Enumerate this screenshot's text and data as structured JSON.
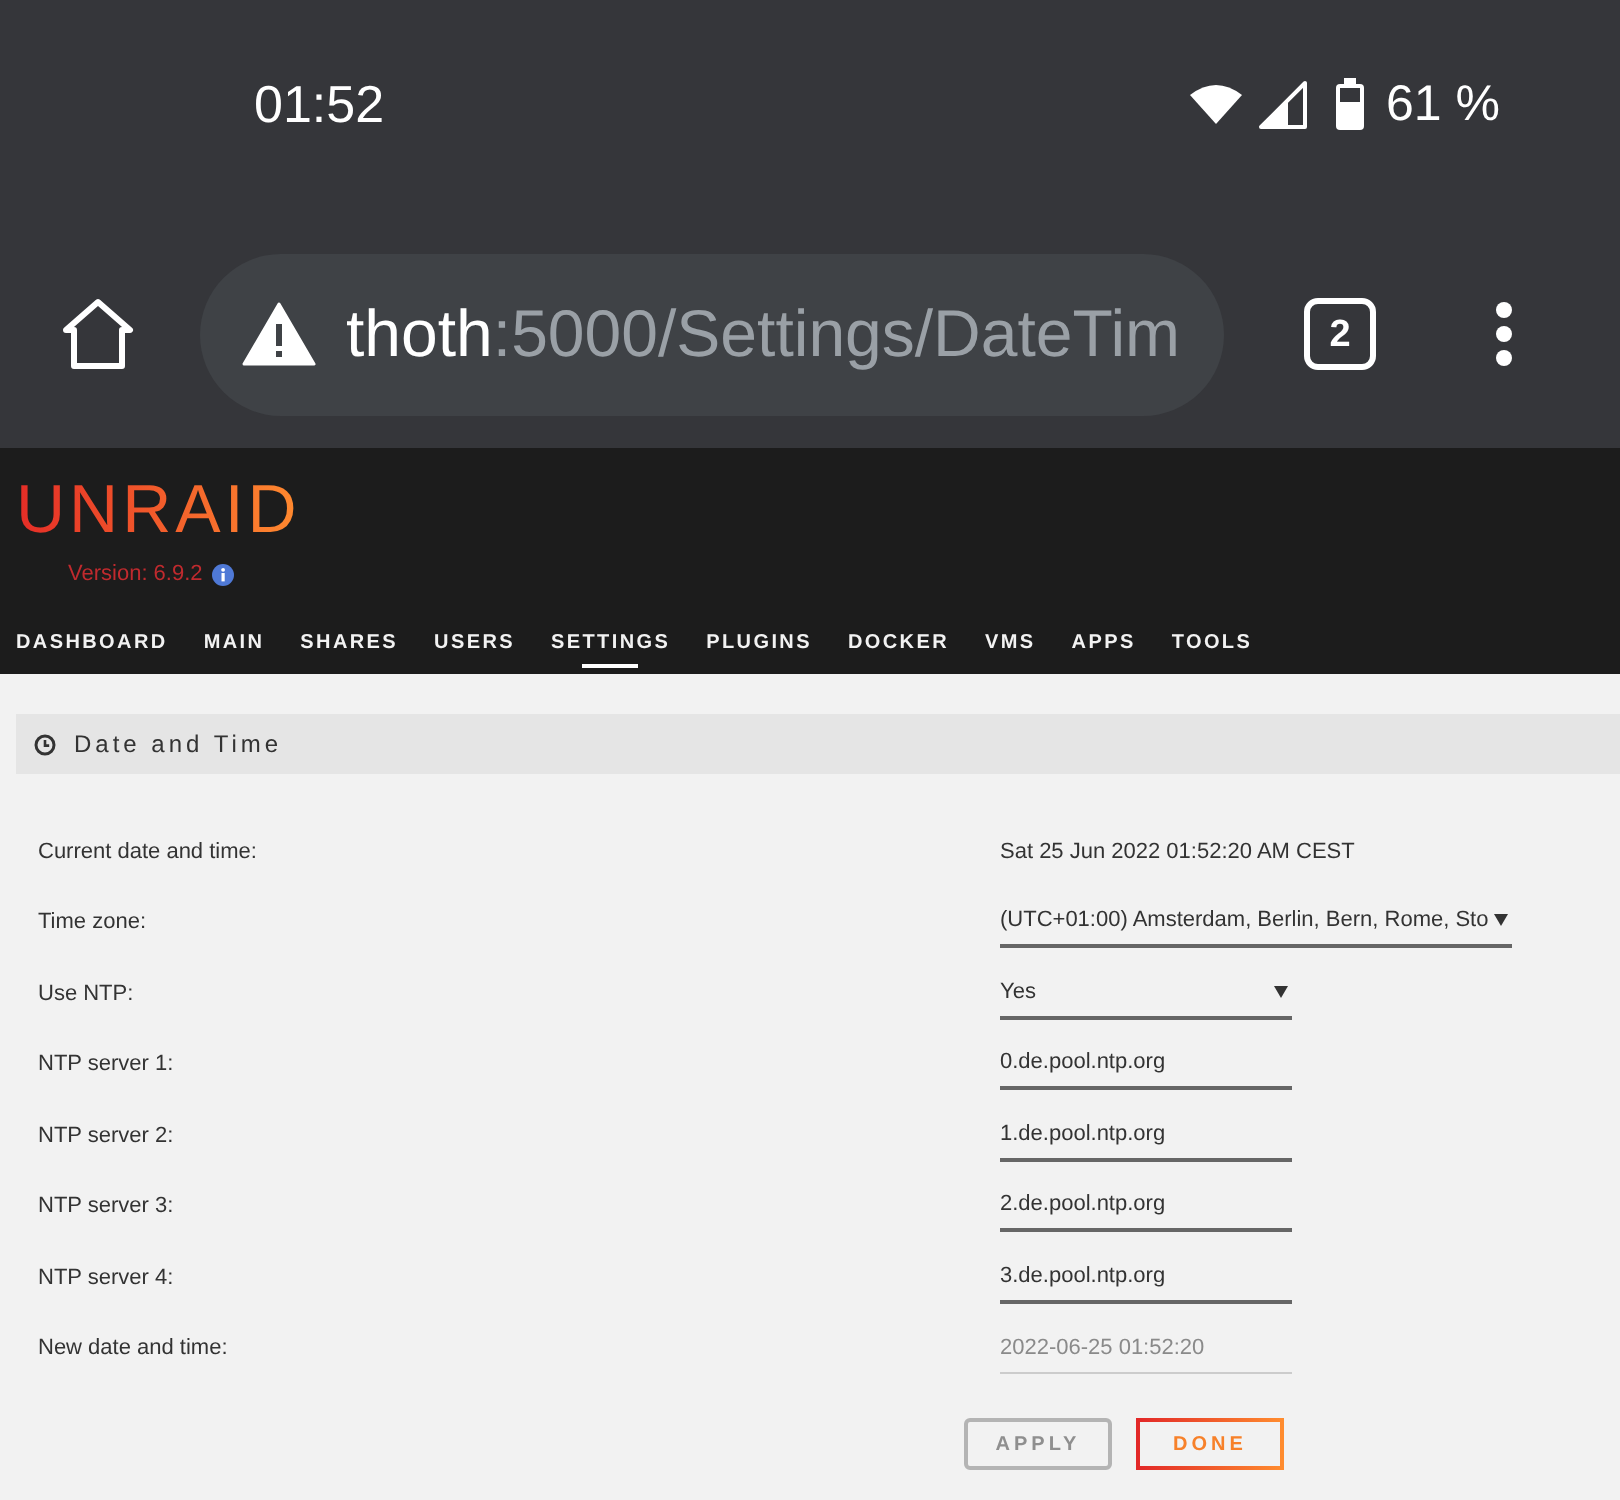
{
  "status_bar": {
    "time": "01:52",
    "battery": "61 %"
  },
  "browser": {
    "host": "thoth",
    "path": ":5000/Settings/DateTim",
    "tab_count": "2"
  },
  "header": {
    "logo": "UNRAID",
    "version": "Version: 6.9.2"
  },
  "nav": [
    {
      "label": "DASHBOARD",
      "selected": false
    },
    {
      "label": "MAIN",
      "selected": false
    },
    {
      "label": "SHARES",
      "selected": false
    },
    {
      "label": "USERS",
      "selected": false
    },
    {
      "label": "SETTINGS",
      "selected": true
    },
    {
      "label": "PLUGINS",
      "selected": false
    },
    {
      "label": "DOCKER",
      "selected": false
    },
    {
      "label": "VMS",
      "selected": false
    },
    {
      "label": "APPS",
      "selected": false
    },
    {
      "label": "TOOLS",
      "selected": false
    }
  ],
  "section": {
    "title": "Date and Time"
  },
  "rows": [
    {
      "kind": "text",
      "label": "Current date and time:",
      "value": "Sat 25 Jun 2022 01:52:20 AM CEST"
    },
    {
      "kind": "select",
      "label": "Time zone:",
      "value": "(UTC+01:00) Amsterdam, Berlin, Bern, Rome, Sto"
    },
    {
      "kind": "select",
      "label": "Use NTP:",
      "value": "Yes"
    },
    {
      "kind": "input",
      "label": "NTP server 1:",
      "value": "0.de.pool.ntp.org",
      "disabled": false
    },
    {
      "kind": "input",
      "label": "NTP server 2:",
      "value": "1.de.pool.ntp.org",
      "disabled": false
    },
    {
      "kind": "input",
      "label": "NTP server 3:",
      "value": "2.de.pool.ntp.org",
      "disabled": false
    },
    {
      "kind": "input",
      "label": "NTP server 4:",
      "value": "3.de.pool.ntp.org",
      "disabled": false
    },
    {
      "kind": "input",
      "label": "New date and time:",
      "value": "2022-06-25 01:52:20",
      "disabled": true
    }
  ],
  "buttons": [
    {
      "label": "APPLY",
      "disabled": true
    },
    {
      "label": "DONE",
      "disabled": false
    }
  ]
}
